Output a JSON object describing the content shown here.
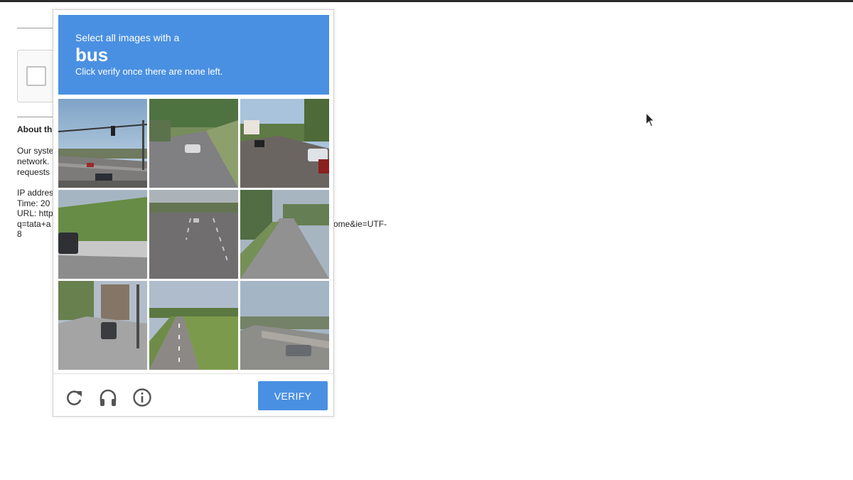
{
  "background_page": {
    "about_heading": "About th",
    "lines": [
      "Our syste",
      "network.",
      "requests",
      "",
      "IP addres",
      "Time: 20",
      "URL: http",
      "q=tata+a",
      "8"
    ],
    "url_tail": "ome&ie=UTF-"
  },
  "captcha": {
    "instruction_small": "Select all images with a",
    "target_word": "bus",
    "instruction_sub": "Click verify once there are none left.",
    "tiles": [
      {
        "index": 1,
        "selected": false
      },
      {
        "index": 2,
        "selected": false
      },
      {
        "index": 3,
        "selected": false
      },
      {
        "index": 4,
        "selected": false
      },
      {
        "index": 5,
        "selected": false
      },
      {
        "index": 6,
        "selected": false
      },
      {
        "index": 7,
        "selected": false
      },
      {
        "index": 8,
        "selected": false
      },
      {
        "index": 9,
        "selected": false
      }
    ],
    "footer": {
      "reload_icon": "reload-icon",
      "audio_icon": "headphones-icon",
      "info_icon": "info-icon",
      "verify_label": "VERIFY"
    },
    "colors": {
      "accent": "#4a90e2"
    }
  }
}
